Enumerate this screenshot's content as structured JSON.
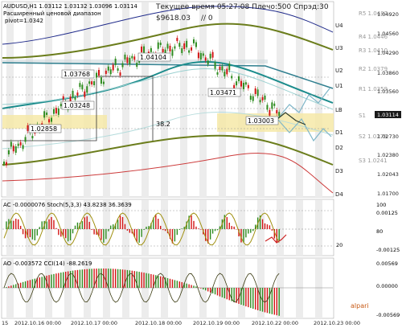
{
  "header": {
    "symbol_line": "AUDUSD,H1  1.03112 1.03132 1.03096 1.03114",
    "indicator_name": "Расширенный ценовой диапазон",
    "pivot_label": "pivot=1.0342",
    "server_time": "Текущее время 05:27:08 Плечо:500 Спрэд:30",
    "balance": "$9618.03",
    "counter": "// 0"
  },
  "price_axis": [
    "1.04920",
    "1.04560",
    "1.04290",
    "1.03860",
    "1.03560",
    "1.03114",
    "1.02730",
    "1.02380",
    "1.02043",
    "1.01700"
  ],
  "level_labels": [
    "U4",
    "R5 1.0487",
    "U3",
    "R4 1.0446",
    "R3 1.0410",
    "U2",
    "R2 1.0379",
    "U1",
    "R1 1.0359",
    "LB",
    "D1",
    "S1",
    "D2",
    "S2 1.0279",
    "D3",
    "S3 1.0241",
    "D4"
  ],
  "price_labels": [
    "1.04104",
    "1.03768",
    "1.03471",
    "1.03248",
    "1.02858",
    "1.03003",
    "38.2"
  ],
  "ac_panel": {
    "title": "AC -0.0000076  Stoch(5,3,3) 43.8238 36.3639",
    "axis": [
      "100",
      "80",
      "20",
      "0.00125",
      "-0.00125"
    ]
  },
  "ao_panel": {
    "title": "AO -0.003572  CCI(14) -88.2619",
    "axis": [
      "0.00569",
      "0.00000",
      "-0.00569"
    ]
  },
  "time_axis": [
    "15",
    "2012.10.16 00:00",
    "2012.10.17 00:00",
    "2012.10.18 00:00",
    "2012.10.19 00:00",
    "2012.10.22 00:00",
    "2012.10.23 00:00"
  ],
  "watermark": "alpari",
  "colors": {
    "bull": "#2e8b1f",
    "bear": "#d31414",
    "teal_ma": "#1b8c8c",
    "olive": "#6b7d1c",
    "zone": "#f6e9a8",
    "navy": "#1f2a8a"
  }
}
